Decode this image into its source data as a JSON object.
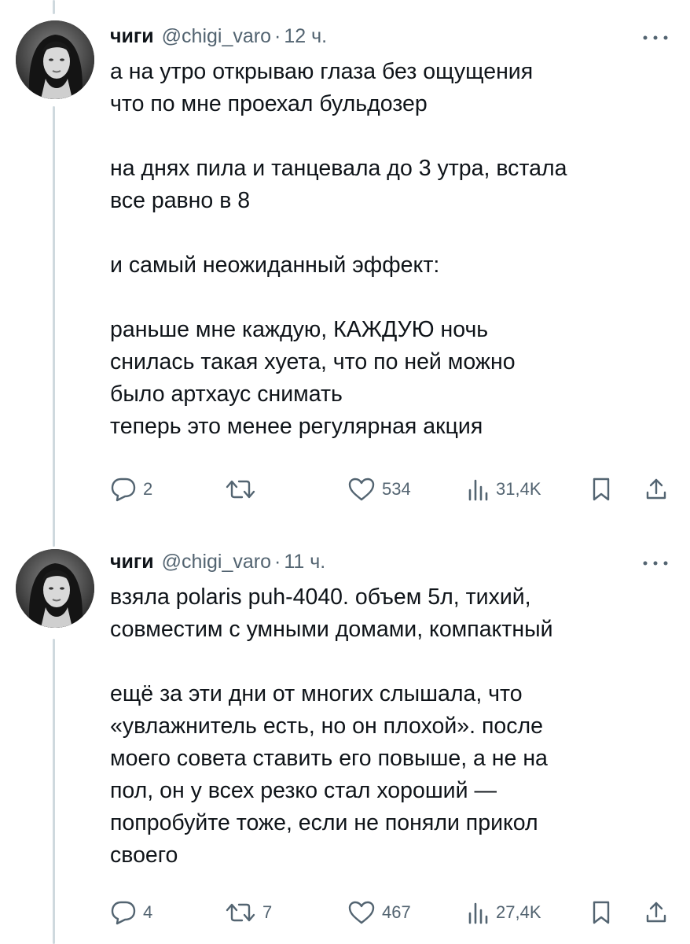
{
  "tweets": [
    {
      "author_name": "чиги",
      "handle": "@chigi_varo",
      "separator": "·",
      "time": "12 ч.",
      "paragraphs": [
        "а на утро открываю глаза без ощущения\nчто по мне проехал бульдозер",
        "на днях пила и танцевала до 3 утра, встала\nвсе равно в 8",
        "и самый неожиданный эффект:",
        "раньше мне каждую, КАЖДУЮ ночь\nснилась такая хуета, что по ней можно\nбыло артхаус снимать\nтеперь это менее регулярная акция"
      ],
      "replies": "2",
      "reposts": "",
      "likes": "534",
      "views": "31,4K"
    },
    {
      "author_name": "чиги",
      "handle": "@chigi_varo",
      "separator": "·",
      "time": "11 ч.",
      "paragraphs": [
        "взяла polaris puh-4040. объем 5л, тихий,\nсовместим с умными домами, компактный",
        "ещё за эти дни от многих слышала, что\n«увлажнитель есть, но он плохой». после\nмоего совета ставить его повыше, а не на\nпол, он у всех резко стал хороший —\nпопробуйте тоже, если не поняли прикол\nсвоего"
      ],
      "replies": "4",
      "reposts": "7",
      "likes": "467",
      "views": "27,4K"
    }
  ],
  "icons": {
    "reply": "speech-bubble-icon",
    "repost": "repost-arrows-icon",
    "like": "heart-outline-icon",
    "views": "bar-chart-icon",
    "bookmark": "bookmark-icon",
    "share": "share-upload-icon",
    "more": "more-dots-icon"
  },
  "colors": {
    "text": "#0f1419",
    "secondary": "#536471",
    "thread_line": "#cfd9de"
  }
}
